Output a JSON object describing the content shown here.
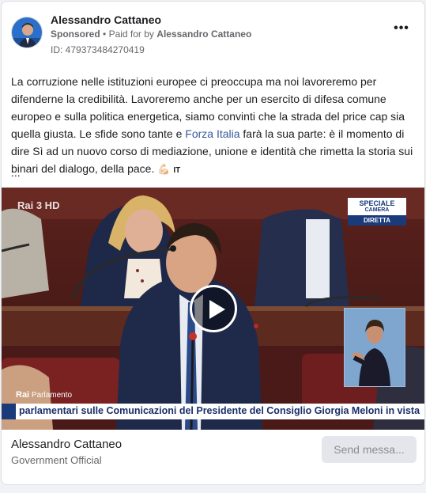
{
  "advertiser": {
    "name": "Alessandro Cattaneo",
    "sponsored_label": "Sponsored",
    "separator": "•",
    "paid_for_prefix": "Paid for by",
    "paid_for_name": "Alessandro Cattaneo",
    "id_text": "ID: 479373484270419"
  },
  "post": {
    "text_part1": "La corruzione nelle istituzioni europee ci preoccupa ma noi lavoreremo per difenderne la credibilità. Lavoreremo anche per un esercito di difesa comune europeo e sulla politica energetica, siamo convinti che la strada del price cap sia quella giusta. Le sfide sono tante e ",
    "link_text": "Forza Italia",
    "text_part2": " farà la sua parte: è il momento di dire Sì ad un nuovo corso di mediazione, unione e identità che rimetta la storia sui binari del dialogo, della pace. ",
    "emoji": "💪🏻",
    "flag_text": "IT",
    "ellipsis": "..."
  },
  "video": {
    "channel_logo": "Rai 3 HD",
    "badge_line1": "SPECIALE",
    "badge_line2": "CAMERA",
    "badge_live": "DIRETTA",
    "lower_brand": "Rai",
    "lower_channel": "Parlamento",
    "ticker_text": "parlamentari sulle Comunicazioni del Presidente del Consiglio Giorgia Meloni in vista",
    "play_icon": "play-icon"
  },
  "footer": {
    "page_name": "Alessandro Cattaneo",
    "page_category": "Government Official",
    "send_button_label": "Send messa..."
  },
  "icons": {
    "more": "more-horizontal-icon"
  },
  "colors": {
    "link": "#385898",
    "muted": "#65676b",
    "button_bg": "#e4e6eb"
  }
}
